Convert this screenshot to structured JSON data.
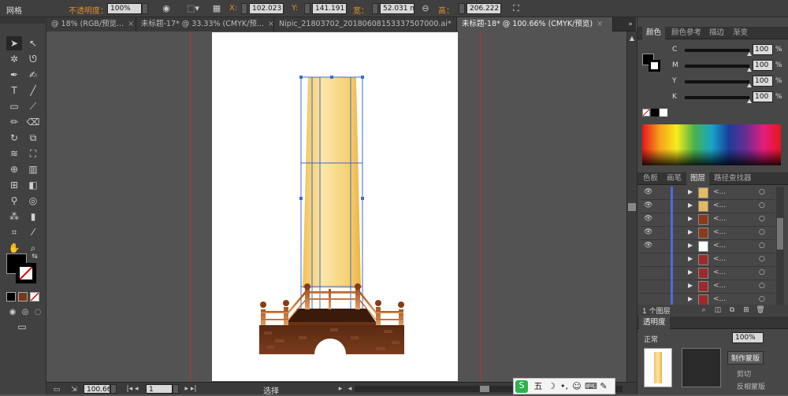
{
  "control_bar": {
    "title": "网格",
    "opacity_label": "不透明度：",
    "opacity_value": "100%",
    "x_label": "X:",
    "x_value": "102.023 m",
    "y_label": "Y:",
    "y_value": "141.191 m",
    "w_label": "宽：",
    "w_value": "52.031 mm",
    "h_label": "高：",
    "h_value": "206.222 m"
  },
  "doc_tabs": [
    {
      "label": "@ 18% (RGB/预览...",
      "close": "×"
    },
    {
      "label": "未标题-17* @ 33.33% (CMYK/预...",
      "close": "×"
    },
    {
      "label": "Nipic_21803702_20180608153337507000.ai*",
      "close": "×"
    },
    {
      "label": "未标题-18* @ 100.66% (CMYK/预览)",
      "close": "×"
    }
  ],
  "status_bar": {
    "zoom": "100.66",
    "page": "1",
    "tool": "选择"
  },
  "color_panel": {
    "tabs": [
      "颜色",
      "颜色参考",
      "描边",
      "渐变"
    ],
    "sliders": [
      {
        "label": "C",
        "value": "100",
        "unit": "%"
      },
      {
        "label": "M",
        "value": "100",
        "unit": "%"
      },
      {
        "label": "Y",
        "value": "100",
        "unit": "%"
      },
      {
        "label": "K",
        "value": "100",
        "unit": "%"
      }
    ]
  },
  "layers_panel": {
    "tabs": [
      "色板",
      "画笔",
      "图层",
      "路径查找器"
    ],
    "rows": [
      {
        "name": "<...",
        "visible": true,
        "thumb": "#e8b860"
      },
      {
        "name": "<...",
        "visible": true,
        "thumb": "#e8b860"
      },
      {
        "name": "<...",
        "visible": true,
        "thumb": "#8b3a1a"
      },
      {
        "name": "<...",
        "visible": true,
        "thumb": "#8b3a1a"
      },
      {
        "name": "<...",
        "visible": true,
        "thumb": "#ffffff"
      },
      {
        "name": "<...",
        "visible": false,
        "thumb": "#9b2a2a"
      },
      {
        "name": "<...",
        "visible": false,
        "thumb": "#9b2a2a"
      },
      {
        "name": "<...",
        "visible": false,
        "thumb": "#9b2a2a"
      },
      {
        "name": "<...",
        "visible": false,
        "thumb": "#9b2a2a"
      }
    ],
    "footer": "1 个图层"
  },
  "transparency_panel": {
    "tab": "透明度",
    "mode": "正常",
    "opacity": "100%",
    "make_mask": "制作蒙版",
    "clip": "剪切",
    "invert": "反相蒙版"
  },
  "ime": {
    "label": "五"
  },
  "colors": {
    "accent": "#e09020",
    "guide": "#c0302a"
  }
}
